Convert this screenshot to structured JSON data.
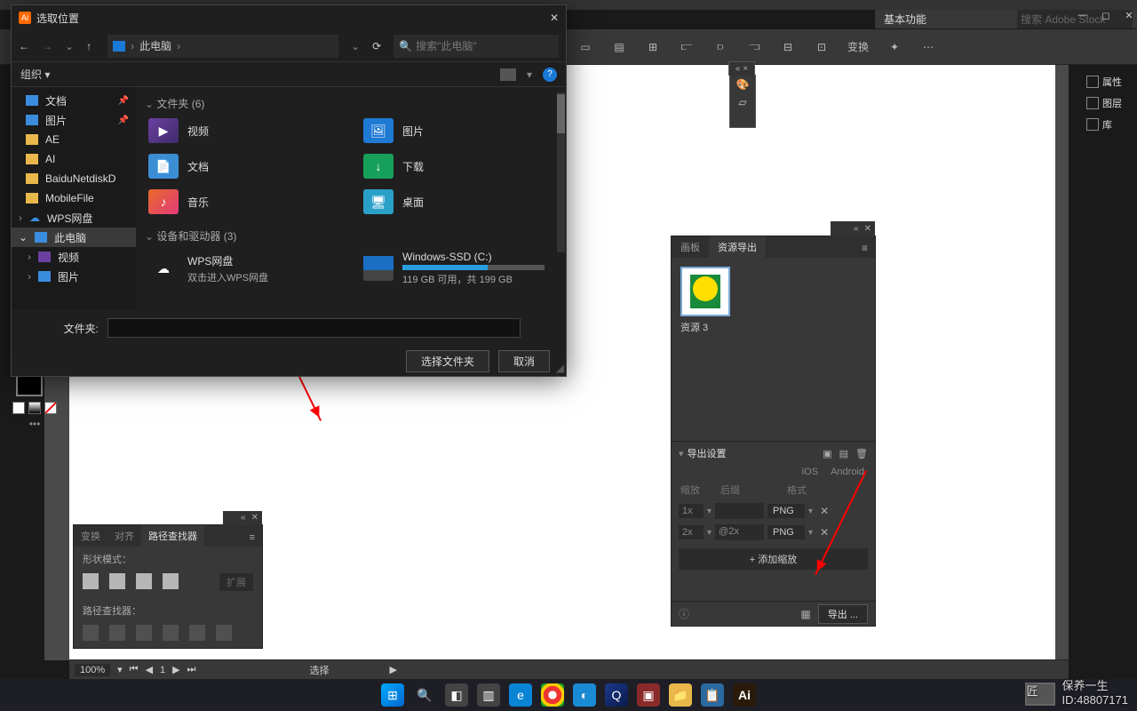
{
  "ai": {
    "essentials": "基本功能",
    "stock_search": "搜索 Adobe Stock",
    "toolbar": {
      "transform": "变换"
    }
  },
  "right_dock": {
    "props": "属性",
    "layers": "图层",
    "libs": "库"
  },
  "mini_close": "×",
  "asset_panel": {
    "tabs": {
      "artboard": "画板",
      "asset_export": "资源导出"
    },
    "asset_label": "资源 3",
    "export_section": "导出设置",
    "ios": "iOS",
    "android": "Android",
    "cols": {
      "scale": "缩放",
      "suffix": "后缀",
      "format": "格式"
    },
    "rows": [
      {
        "scale": "1x",
        "suffix": "",
        "format": "PNG"
      },
      {
        "scale": "2x",
        "suffix": "@2x",
        "format": "PNG"
      }
    ],
    "add_scale": "+ 添加缩放",
    "export_btn": "导出 ..."
  },
  "pathfinder": {
    "tabs": {
      "transform": "变换",
      "align": "对齐",
      "pathfinder": "路径查找器"
    },
    "shape_mode": "形状模式：",
    "expand": "扩展",
    "pf_label": "路径查找器："
  },
  "status": {
    "zoom": "100%",
    "page": "1",
    "select": "选择"
  },
  "dialog": {
    "title": "选取位置",
    "path_label": "此电脑",
    "search_placeholder": "搜索\"此电脑\"",
    "organize": "组织",
    "sidebar": {
      "docs": "文档",
      "images": "图片",
      "ae": "AE",
      "ai": "AI",
      "baidu": "BaiduNetdiskD",
      "mobile": "MobileFile",
      "wps": "WPS网盘",
      "thispc": "此电脑",
      "video": "视频",
      "pic2": "图片"
    },
    "sections": {
      "folders": "文件夹 (6)",
      "devices": "设备和驱动器 (3)"
    },
    "folders": {
      "video": "视频",
      "images": "图片",
      "docs": "文档",
      "downloads": "下载",
      "music": "音乐",
      "desktop": "桌面"
    },
    "wps_drive": {
      "name": "WPS网盘",
      "sub": "双击进入WPS网盘"
    },
    "c_drive": {
      "name": "Windows-SSD (C:)",
      "info": "119 GB 可用，共 199 GB"
    },
    "folder_field_label": "文件夹:",
    "select_btn": "选择文件夹",
    "cancel_btn": "取消"
  },
  "watermark": {
    "line1": "保养一生",
    "line2": "ID:48807171"
  }
}
